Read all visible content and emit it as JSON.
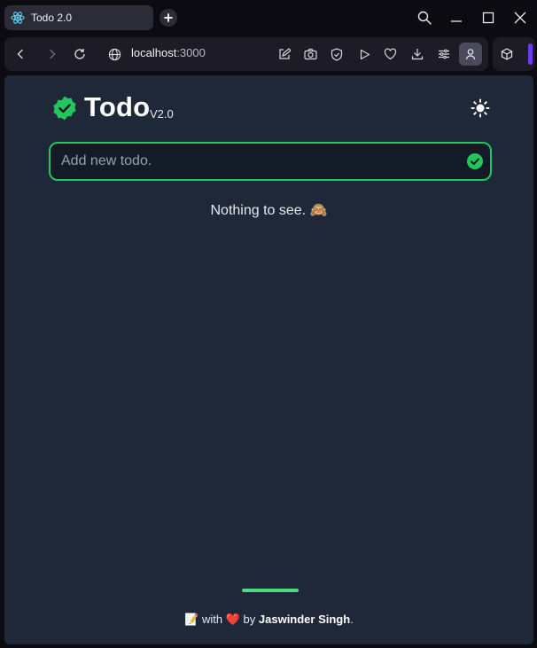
{
  "browser": {
    "tab": {
      "title": "Todo 2.0",
      "icon": "react-icon"
    },
    "new_tab_icon": "plus-icon",
    "window_controls": [
      "search-icon",
      "minimize-icon",
      "maximize-icon",
      "close-icon"
    ],
    "address": {
      "host": "localhost",
      "port": ":3000"
    },
    "toolbar_icons": [
      "back-icon",
      "forward-icon",
      "reload-icon",
      "globe-icon",
      "edit-icon",
      "camera-icon",
      "shield-icon",
      "play-icon",
      "heart-icon",
      "download-icon",
      "sliders-icon",
      "profile-icon",
      "extension-cube-icon"
    ],
    "accent_color": "#6a3cf0"
  },
  "app": {
    "title": "Todo",
    "version": "V2.0",
    "brand_color": "#22c55e",
    "theme_toggle_icon": "sun-icon",
    "input": {
      "placeholder": "Add new todo.",
      "value": ""
    },
    "empty_message": "Nothing to see.",
    "empty_emoji": "🙈",
    "footer": {
      "prefix_emoji": "📝",
      "with": "with",
      "heart": "❤️",
      "by": "by",
      "author": "Jaswinder Singh",
      "suffix": "."
    }
  }
}
